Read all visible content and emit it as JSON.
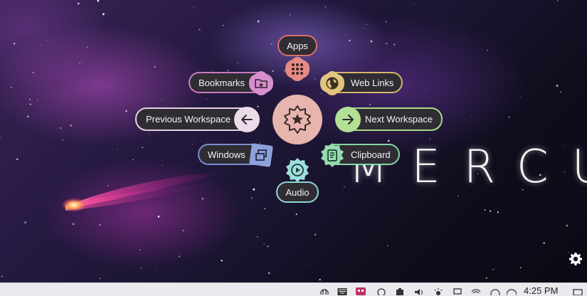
{
  "desktop": {
    "wallpaper_title": "MERCURY"
  },
  "menu": {
    "center_icon": "star-badge-icon",
    "items": {
      "apps": {
        "label": "Apps",
        "icon": "grid-dots-icon",
        "color": "#d9706a"
      },
      "bookmarks": {
        "label": "Bookmarks",
        "icon": "star-folder-icon",
        "color": "#c77bbf"
      },
      "web_links": {
        "label": "Web Links",
        "icon": "globe-icon",
        "color": "#d8b56a"
      },
      "previous_workspace": {
        "label": "Previous Workspace",
        "icon": "arrow-left-icon",
        "color": "#e6cfe0"
      },
      "next_workspace": {
        "label": "Next Workspace",
        "icon": "arrow-right-icon",
        "color": "#a9d98a"
      },
      "windows": {
        "label": "Windows",
        "icon": "windows-stack-icon",
        "color": "#7b8fcf"
      },
      "clipboard": {
        "label": "Clipboard",
        "icon": "clipboard-icon",
        "color": "#86d6a6"
      },
      "audio": {
        "label": "Audio",
        "icon": "play-circle-icon",
        "color": "#8fd6d2"
      }
    }
  },
  "settings": {
    "icon": "gear-icon"
  },
  "taskbar": {
    "clock": "4:25 PM",
    "tray_icons": [
      "network-icon",
      "keyboard-icon",
      "app-icon",
      "chat-icon",
      "battery-icon",
      "volume-icon",
      "brightness-icon",
      "display-icon",
      "wifi-icon",
      "notification-icon"
    ]
  }
}
